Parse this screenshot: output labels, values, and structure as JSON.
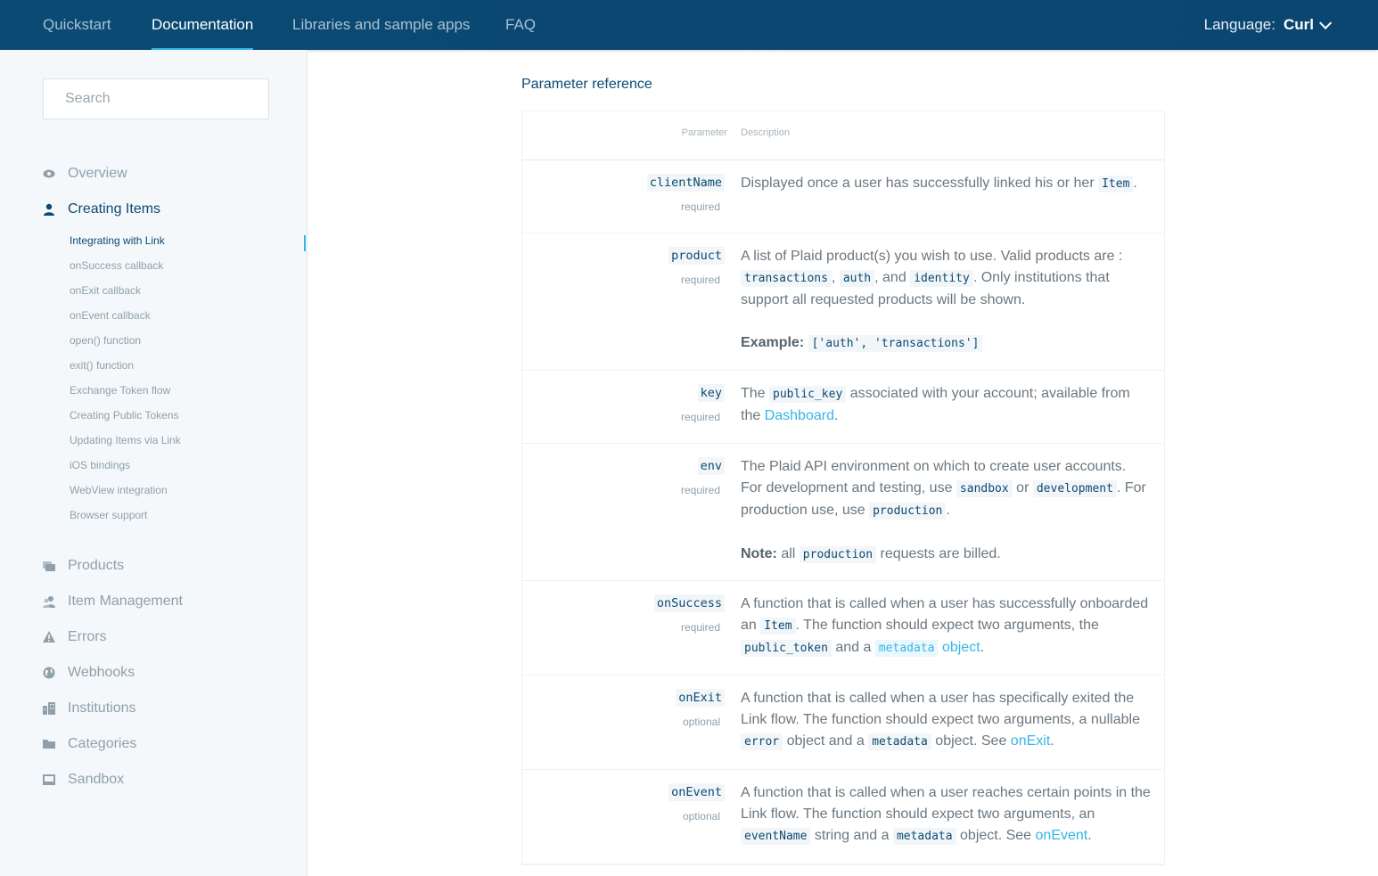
{
  "topnav": {
    "items": [
      "Quickstart",
      "Documentation",
      "Libraries and sample apps",
      "FAQ"
    ],
    "language_label": "Language:",
    "language_value": "Curl"
  },
  "sidebar": {
    "search_placeholder": "Search",
    "sections": [
      {
        "label": "Overview",
        "icon": "eye-icon"
      },
      {
        "label": "Creating Items",
        "icon": "user-icon"
      },
      {
        "label": "Products",
        "icon": "layers-icon"
      },
      {
        "label": "Item Management",
        "icon": "users-icon"
      },
      {
        "label": "Errors",
        "icon": "warning-icon"
      },
      {
        "label": "Webhooks",
        "icon": "globe-icon"
      },
      {
        "label": "Institutions",
        "icon": "building-icon"
      },
      {
        "label": "Categories",
        "icon": "folder-icon"
      },
      {
        "label": "Sandbox",
        "icon": "inbox-icon"
      }
    ],
    "subitems": [
      "Integrating with Link",
      "onSuccess callback",
      "onExit callback",
      "onEvent callback",
      "open() function",
      "exit() function",
      "Exchange Token flow",
      "Creating Public Tokens",
      "Updating Items via Link",
      "iOS bindings",
      "WebView integration",
      "Browser support"
    ]
  },
  "content": {
    "title": "Parameter reference",
    "col_param": "Parameter",
    "col_desc": "Description",
    "rows": [
      {
        "name": "clientName",
        "req": "required",
        "t1": "Displayed once a user has successfully linked his or her ",
        "c1": "Item",
        "t2": "."
      },
      {
        "name": "product",
        "req": "required",
        "t1": "A list of Plaid product(s) you wish to use. Valid products are :",
        "c1": "transactions",
        "t2": ",",
        "c2": "auth",
        "t3": ", and",
        "c3": "identity",
        "t4": ". Only institutions that support all requested products will be shown.",
        "ex_label": "Example:",
        "ex_code": "['auth', 'transactions']"
      },
      {
        "name": "key",
        "req": "required",
        "t1": "The ",
        "c1": "public_key",
        "t2": " associated with your account; available from the ",
        "link": "Dashboard",
        "t3": "."
      },
      {
        "name": "env",
        "req": "required",
        "t1": "The Plaid API environment on which to create user accounts. For development and testing, use ",
        "c1": "sandbox",
        "t2": " or ",
        "c2": "development",
        "t3": ". For production use, use ",
        "c3": "production",
        "t4": ".",
        "note_label": "Note:",
        "note_t1": " all ",
        "note_code": "production",
        "note_t2": " requests are billed."
      },
      {
        "name": "onSuccess",
        "req": "required",
        "t1": "A function that is called when a user has successfully onboarded an ",
        "c1": "Item",
        "t2": ". The function should expect two arguments, the ",
        "c2": "public_token",
        "t3": " and a ",
        "c3": "metadata",
        "link": "object",
        "t4": "."
      },
      {
        "name": "onExit",
        "req": "optional",
        "t1": "A function that is called when a user has specifically exited the Link flow. The function should expect two arguments, a nullable ",
        "c1": "error",
        "t2": " object and a ",
        "c2": "metadata",
        "t3": " object. See ",
        "link": "onExit",
        "t4": "."
      },
      {
        "name": "onEvent",
        "req": "optional",
        "t1": "A function that is called when a user reaches certain points in the Link flow. The function should expect two arguments, an ",
        "c1": "eventName",
        "t2": " string and a ",
        "c2": "metadata",
        "t3": " object. See ",
        "link": "onEvent",
        "t4": "."
      }
    ]
  }
}
